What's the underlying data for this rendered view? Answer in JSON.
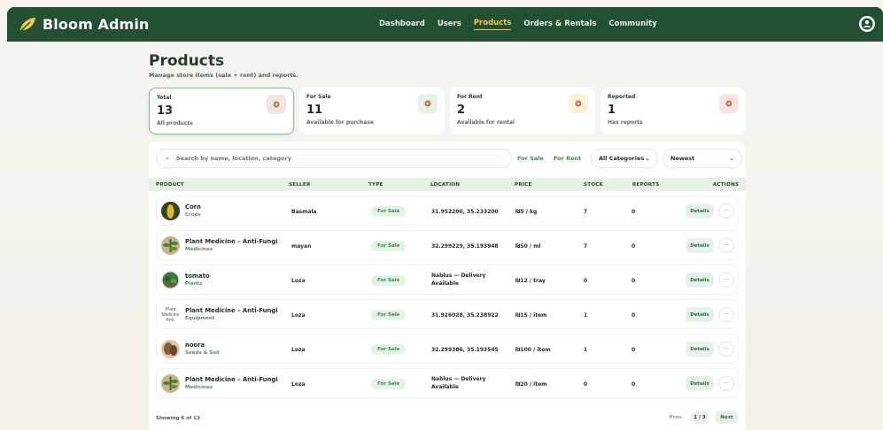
{
  "app": {
    "title": "Bloom Admin"
  },
  "nav": {
    "items": [
      {
        "label": "Dashboard",
        "active": false
      },
      {
        "label": "Users",
        "active": false
      },
      {
        "label": "Products",
        "active": true
      },
      {
        "label": "Orders & Rentals",
        "active": false
      },
      {
        "label": "Community",
        "active": false
      }
    ]
  },
  "header": {
    "title": "Products",
    "subtitle": "Manage store items (sale + rent) and reports."
  },
  "stats": [
    {
      "label": "Total",
      "value": "13",
      "desc": "All products",
      "icon_color": "#efe7e2",
      "selected": true
    },
    {
      "label": "For Sale",
      "value": "11",
      "desc": "Available for purchase",
      "icon_color": "#e3f3e5",
      "selected": false
    },
    {
      "label": "For Rent",
      "value": "2",
      "desc": "Available for rental",
      "icon_color": "#fbf0d8",
      "selected": false
    },
    {
      "label": "Reported",
      "value": "1",
      "desc": "Has reports",
      "icon_color": "#fbe3e3",
      "selected": false
    }
  ],
  "filters": {
    "search_placeholder": "Search by name, location, category",
    "sale_label": "For Sale",
    "rent_label": "For Rent",
    "category_value": "All Categories",
    "sort_value": "Newest"
  },
  "table": {
    "columns": [
      "PRODUCT",
      "SELLER",
      "TYPE",
      "LOCATION",
      "PRICE",
      "STOCK",
      "REPORTS",
      "ACTIONS"
    ],
    "rows": [
      {
        "name": "Corn",
        "category": "Crops",
        "seller": "Basmala",
        "type": "For Sale",
        "location": "31.952200, 35.233200",
        "location2": "",
        "price": "₪5 / kg",
        "stock": "7",
        "reports": "0",
        "thumb": "corn"
      },
      {
        "name": "Plant Medicine – Anti-Fungi",
        "category": "Medicines",
        "seller": "mayan",
        "type": "For Sale",
        "location": "32.299229, 35.193948",
        "location2": "",
        "price": "₪50 / ml",
        "stock": "7",
        "reports": "0",
        "thumb": "plant"
      },
      {
        "name": "tomato",
        "category": "Plants",
        "seller": "Loza",
        "type": "For Sale",
        "location": "Nablus — Delivery",
        "location2": "Available",
        "price": "₪12 / tray",
        "stock": "0",
        "reports": "0",
        "thumb": "tomato"
      },
      {
        "name": "Plant Medicine – Anti-Fungi",
        "category": "Equipment",
        "seller": "Loza",
        "type": "For Sale",
        "location": "31.926028, 35.238922",
        "location2": "",
        "price": "₪15 / item",
        "stock": "1",
        "reports": "0",
        "thumb": "broken",
        "thumb_alt": "Plant Medicine Anti-"
      },
      {
        "name": "noora",
        "category": "Seeds & Soil",
        "seller": "Loza",
        "type": "For Sale",
        "location": "32.299386, 35.193545",
        "location2": "",
        "price": "₪100 / item",
        "stock": "1",
        "reports": "0",
        "thumb": "seed"
      },
      {
        "name": "Plant Medicine – Anti-Fungi",
        "category": "Medicines",
        "seller": "Loza",
        "type": "For Sale",
        "location": "Nablus — Delivery",
        "location2": "Available",
        "price": "₪20 / item",
        "stock": "0",
        "reports": "0",
        "thumb": "plant"
      }
    ],
    "details_label": "Details",
    "more_label": "···"
  },
  "footer": {
    "showing_prefix": "Showing",
    "showing_count": "6",
    "showing_of": "of",
    "showing_total": "13",
    "prev_label": "Prev",
    "page_indicator": "1 / 3",
    "next_label": "Next"
  }
}
